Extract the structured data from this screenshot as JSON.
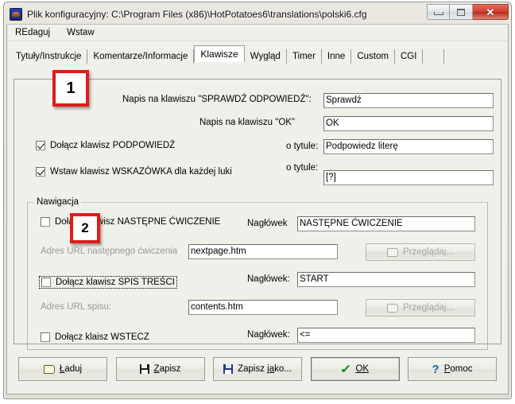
{
  "window": {
    "title": "Plik konfiguracyjny: C:\\Program Files (x86)\\HotPotatoes6\\translations\\polski6.cfg",
    "icon": "hot-potato-icon",
    "minimize_glyph": "minimize-icon",
    "maximize_glyph": "maximize-icon",
    "close_glyph": "✕"
  },
  "menubar": {
    "items": [
      {
        "label": "REdaguj"
      },
      {
        "label": "Wstaw"
      }
    ]
  },
  "tabs": {
    "selected": "Klawisze",
    "items": [
      {
        "label": "Tytuły/Instrukcje",
        "selected": false
      },
      {
        "label": "Komentarze/Informacje",
        "selected": false
      },
      {
        "label": "Klawisze",
        "selected": true
      },
      {
        "label": "Wygląd",
        "selected": false
      },
      {
        "label": "Timer",
        "selected": false
      },
      {
        "label": "Inne",
        "selected": false
      },
      {
        "label": "Custom",
        "selected": false
      },
      {
        "label": "CGI",
        "selected": false
      }
    ]
  },
  "keys_page": {
    "check_answer_label": "Napis na klawiszu \"SPRAWDŹ ODPOWIEDŹ\":",
    "check_answer_value": "Sprawdź",
    "ok_label": "Napis na klawiszu \"OK\"",
    "ok_value": "OK",
    "hint_checkbox_label": "Dołącz klawisz PODPOWIEDŹ",
    "hint_checkbox_checked": true,
    "hint_title_label": "o tytule:",
    "hint_title_value": "Podpowiedz literę",
    "clue_checkbox_label": "Wstaw klawisz WSKAZÓWKA dla każdej luki",
    "clue_checkbox_checked": true,
    "clue_title_label": "o tytule:",
    "clue_title_value": "[?]"
  },
  "navigation": {
    "group_title": "Nawigacja",
    "next_checkbox_label": "Dołącz klawisz NASTĘPNE ĆWICZENIE",
    "next_checkbox_checked": false,
    "next_caption_label": "Nagłówek",
    "next_caption_value": "NASTĘPNE ĆWICZENIE",
    "next_url_label": "Adres URL następnego ćwiczenia",
    "next_url_value": "nextpage.htm",
    "next_browse_label": "Przeglądaj...",
    "contents_checkbox_label": "Dołącz klawisz SPIS TREŚCI",
    "contents_checkbox_checked": false,
    "contents_caption_label": "Nagłówek:",
    "contents_caption_value": "START",
    "contents_url_label": "Adres URL spisu:",
    "contents_url_value": "contents.htm",
    "contents_browse_label": "Przeglądaj...",
    "back_checkbox_label": "Dołącz klaisz WSTECZ",
    "back_checkbox_checked": false,
    "back_caption_label": "Nagłówek:",
    "back_caption_value": "<="
  },
  "footer": {
    "load_label": "Ładuj",
    "save_label": "Zapisz",
    "save_as_label": "Zapisz jako...",
    "ok_label": "OK",
    "help_label": "Pomoc"
  },
  "annotations": [
    {
      "number": "1"
    },
    {
      "number": "2"
    }
  ],
  "colors": {
    "annotation_red": "#e01b18",
    "window_bg": "#f0f0ea",
    "close_button": "#cf4134",
    "ok_check_green": "#0c8a1e",
    "help_blue": "#0b6fa4"
  }
}
